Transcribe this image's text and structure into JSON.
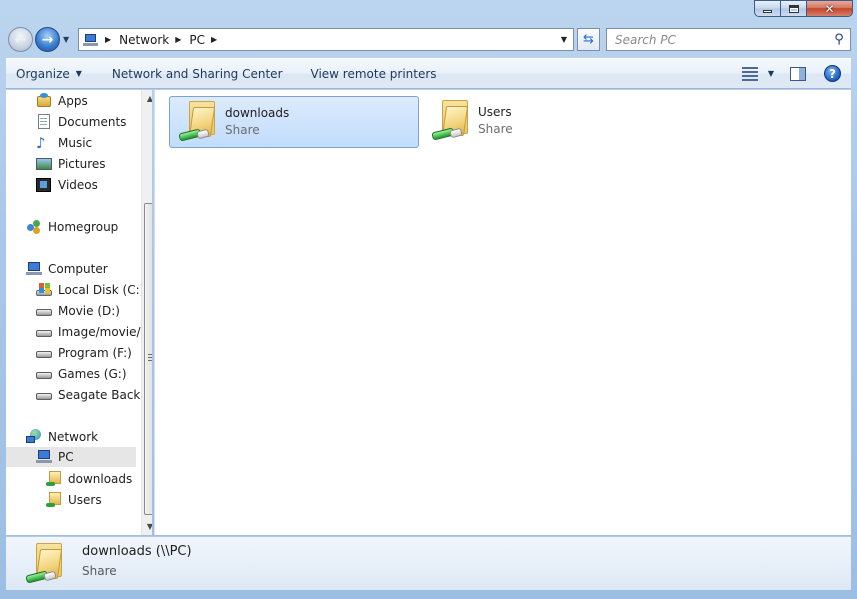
{
  "window": {
    "caption": {
      "minimize": "–",
      "maximize": "□",
      "close": "✕"
    }
  },
  "nav": {
    "back_icon": "back-arrow-icon",
    "forward_icon": "forward-arrow-icon",
    "address_crumbs": [
      "Network",
      "PC"
    ],
    "search_placeholder": "Search PC",
    "refresh_icon": "refresh-icon",
    "search_icon": "magnifier-icon"
  },
  "toolbar": {
    "organize": "Organize",
    "network_sharing": "Network and Sharing Center",
    "remote_printers": "View remote printers",
    "help": "?"
  },
  "sidebar": {
    "libraries": [
      {
        "label": "Apps",
        "icon": "apps-icon"
      },
      {
        "label": "Documents",
        "icon": "documents-icon"
      },
      {
        "label": "Music",
        "icon": "music-icon"
      },
      {
        "label": "Pictures",
        "icon": "pictures-icon"
      },
      {
        "label": "Videos",
        "icon": "videos-icon"
      }
    ],
    "homegroup": "Homegroup",
    "computer": "Computer",
    "drives": [
      {
        "label": "Local Disk (C:)"
      },
      {
        "label": "Movie (D:)"
      },
      {
        "label": "Image/movie/I"
      },
      {
        "label": "Program (F:)"
      },
      {
        "label": "Games (G:)"
      },
      {
        "label": "Seagate Backup"
      }
    ],
    "network": "Network",
    "pc": "PC",
    "shares": [
      {
        "label": "downloads"
      },
      {
        "label": "Users"
      }
    ]
  },
  "content": {
    "items": [
      {
        "name": "downloads",
        "type": "Share",
        "selected": true
      },
      {
        "name": "Users",
        "type": "Share",
        "selected": false
      }
    ]
  },
  "details": {
    "title": "downloads (\\\\PC)",
    "subtitle": "Share"
  },
  "colors": {
    "selection": "#c1dcfc",
    "chrome": "#a9c7e9",
    "close_button": "#c2462c"
  }
}
